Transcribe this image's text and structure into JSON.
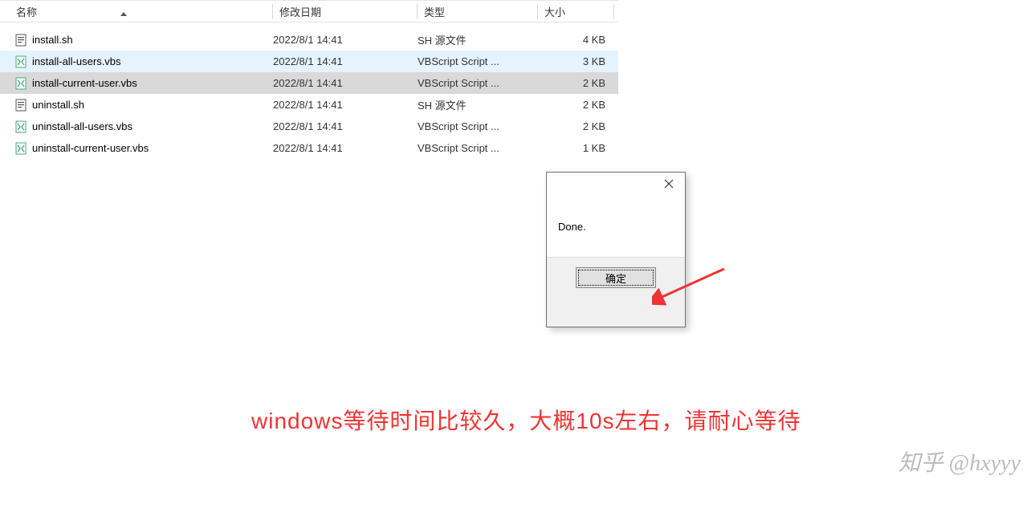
{
  "columns": {
    "name": "名称",
    "date": "修改日期",
    "type": "类型",
    "size": "大小"
  },
  "files": [
    {
      "icon": "sh",
      "name": "install.sh",
      "date": "2022/8/1 14:41",
      "type": "SH 源文件",
      "size": "4 KB",
      "state": "normal"
    },
    {
      "icon": "vbs",
      "name": "install-all-users.vbs",
      "date": "2022/8/1 14:41",
      "type": "VBScript Script ...",
      "size": "3 KB",
      "state": "hover"
    },
    {
      "icon": "vbs",
      "name": "install-current-user.vbs",
      "date": "2022/8/1 14:41",
      "type": "VBScript Script ...",
      "size": "2 KB",
      "state": "selected"
    },
    {
      "icon": "sh",
      "name": "uninstall.sh",
      "date": "2022/8/1 14:41",
      "type": "SH 源文件",
      "size": "2 KB",
      "state": "normal"
    },
    {
      "icon": "vbs",
      "name": "uninstall-all-users.vbs",
      "date": "2022/8/1 14:41",
      "type": "VBScript Script ...",
      "size": "2 KB",
      "state": "normal"
    },
    {
      "icon": "vbs",
      "name": "uninstall-current-user.vbs",
      "date": "2022/8/1 14:41",
      "type": "VBScript Script ...",
      "size": "1 KB",
      "state": "normal"
    }
  ],
  "dialog": {
    "message": "Done.",
    "ok_label": "确定"
  },
  "caption": "windows等待时间比较久，大概10s左右，请耐心等待",
  "watermark": "知乎 @hxyyy"
}
